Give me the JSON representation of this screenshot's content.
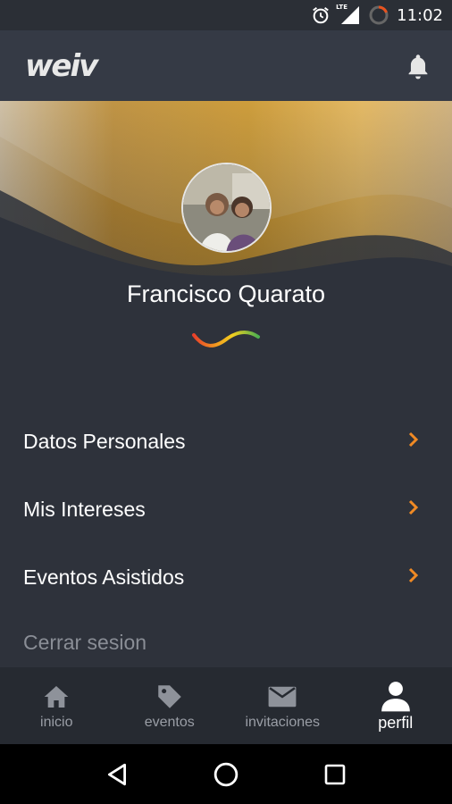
{
  "status_bar": {
    "time": "11:02",
    "network_label": "LTE",
    "icons": [
      "alarm-icon",
      "lte-signal-icon",
      "battery-icon"
    ]
  },
  "app_bar": {
    "logo_text": "weiv",
    "icons": [
      "bell-icon"
    ]
  },
  "profile": {
    "name": "Francisco Quarato"
  },
  "menu": {
    "items": [
      {
        "label": "Datos Personales"
      },
      {
        "label": "Mis Intereses"
      },
      {
        "label": "Eventos Asistidos"
      }
    ],
    "logout_label": "Cerrar sesion"
  },
  "bottom_nav": {
    "items": [
      {
        "label": "inicio",
        "icon": "home-icon",
        "active": false
      },
      {
        "label": "eventos",
        "icon": "tag-icon",
        "active": false
      },
      {
        "label": "invitaciones",
        "icon": "mail-icon",
        "active": false
      },
      {
        "label": "perfil",
        "icon": "person-icon",
        "active": true
      }
    ]
  },
  "system_nav": {
    "icons": [
      "back-icon",
      "home-circle-icon",
      "recents-icon"
    ]
  },
  "colors": {
    "accent": "#f08a24",
    "background": "#2e323b",
    "app_bar": "#353a45",
    "bottom_nav": "#262a31"
  }
}
